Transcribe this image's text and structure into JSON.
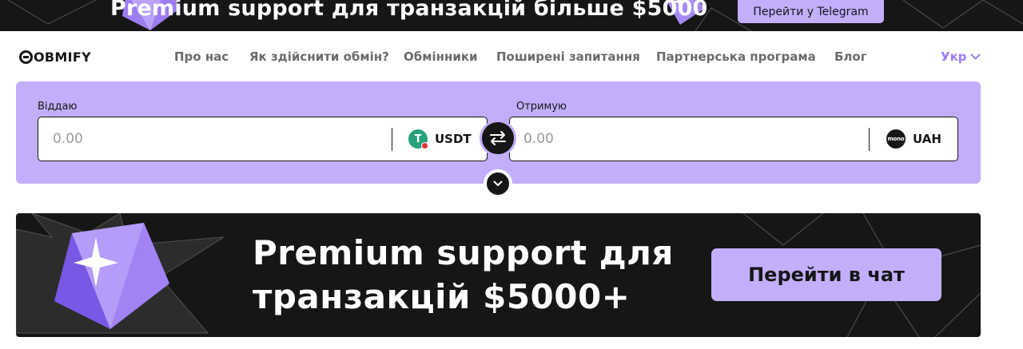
{
  "top_banner": {
    "title": "Premium support для транзакцій більше $5000",
    "button_label": "Перейти у Telegram"
  },
  "nav": {
    "logo": "OBMIFY",
    "links": [
      "Про нас",
      "Як здійснити обмін?",
      "Обмінники",
      "Поширені запитання",
      "Партнерська програма",
      "Блог"
    ],
    "language": "Укр"
  },
  "exchange": {
    "give": {
      "label": "Віддаю",
      "placeholder": "0.00",
      "currency": "USDT",
      "currency_icon": "tether-icon"
    },
    "receive": {
      "label": "Отримую",
      "placeholder": "0.00",
      "currency": "UAH",
      "currency_icon": "monobank-icon",
      "icon_text": "mono"
    },
    "swap_icon": "swap-arrows-icon",
    "expand_icon": "chevron-down-icon"
  },
  "promo": {
    "title_line1": "Premium support для",
    "title_line2": "транзакцій $5000+",
    "button_label": "Перейти в чат"
  },
  "colors": {
    "accent": "#c2aefb",
    "dark": "#161616",
    "accent_text": "#9d7cf2",
    "nav_text": "#6b6b6b"
  }
}
